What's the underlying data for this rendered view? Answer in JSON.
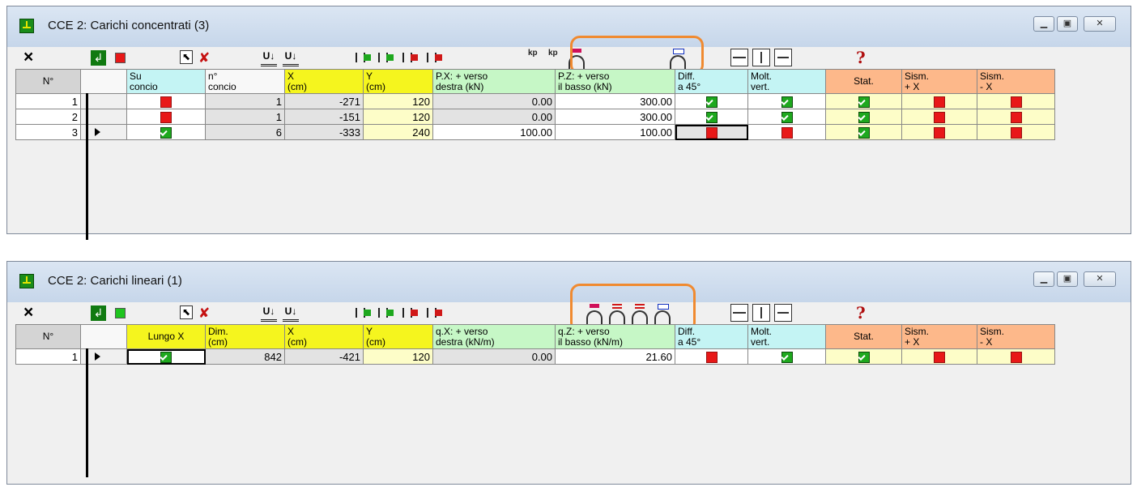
{
  "window1": {
    "title": "CCE 2: Carichi concentrati (3)",
    "headers": [
      "N°",
      "",
      "Su\nconcio",
      "n°\nconcio",
      "X\n(cm)",
      "Y\n(cm)",
      "P.X: + verso\ndestra (kN)",
      "P.Z: + verso\nil basso (kN)",
      "Diff.\na 45°",
      "Molt.\nvert.",
      "Stat.",
      "Sism.\n+ X",
      "Sism.\n- X"
    ],
    "rows": [
      {
        "n": "1",
        "su_concio": "off",
        "n_concio": "1",
        "x": "-271",
        "y": "120",
        "px": "0.00",
        "pz": "300.00",
        "diff": "on",
        "molt": "on",
        "stat": "on",
        "sism_px": "off",
        "sism_mx": "off"
      },
      {
        "n": "2",
        "su_concio": "off",
        "n_concio": "1",
        "x": "-151",
        "y": "120",
        "px": "0.00",
        "pz": "300.00",
        "diff": "on",
        "molt": "on",
        "stat": "on",
        "sism_px": "off",
        "sism_mx": "off"
      },
      {
        "n": "3",
        "su_concio": "on",
        "n_concio": "6",
        "x": "-333",
        "y": "240",
        "px": "100.00",
        "pz": "100.00",
        "diff": "off",
        "molt": "off",
        "stat": "on",
        "sism_px": "off",
        "sism_mx": "off"
      }
    ],
    "current_row": 3,
    "status_square_color": "#e81818"
  },
  "window2": {
    "title": "CCE 2: Carichi lineari (1)",
    "headers": [
      "N°",
      "",
      "Lungo X",
      "Dim.\n(cm)",
      "X\n(cm)",
      "Y\n(cm)",
      "q.X: + verso\ndestra (kN/m)",
      "q.Z: + verso\nil basso (kN/m)",
      "Diff.\na 45°",
      "Molt.\nvert.",
      "Stat.",
      "Sism.\n+ X",
      "Sism.\n- X"
    ],
    "rows": [
      {
        "n": "1",
        "lungo_x": "on",
        "dim": "842",
        "x": "-421",
        "y": "120",
        "qx": "0.00",
        "qz": "21.60",
        "diff": "off",
        "molt": "on",
        "stat": "on",
        "sism_px": "off",
        "sism_mx": "off"
      }
    ],
    "current_row": 1,
    "status_square_color": "#1ec41e"
  },
  "toolbar": {
    "close_glyph": "×",
    "kp_label": "kp",
    "u_label": "U↓",
    "help_glyph": "?"
  },
  "icons": [
    "close-icon",
    "enter-icon",
    "pointer-icon",
    "no-pointer-icon",
    "insert-row-icon",
    "insert-column-icon",
    "bridge-load-icon",
    "help-icon"
  ],
  "colors": {
    "highlight": "#f08a30",
    "check_on": "#1ea81e",
    "check_off": "#e81818"
  }
}
